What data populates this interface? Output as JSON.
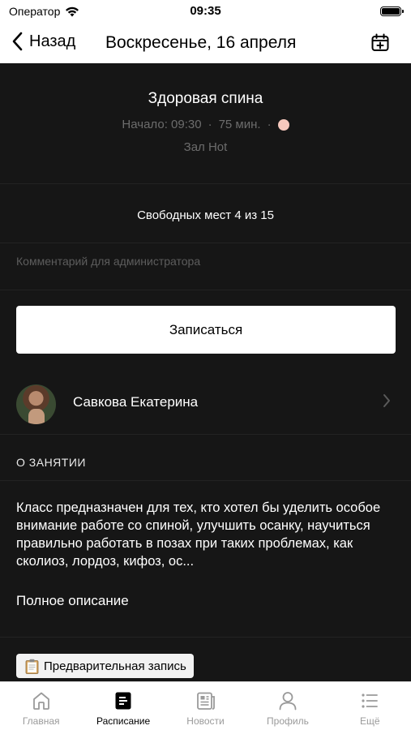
{
  "status_bar": {
    "carrier": "Оператор",
    "time": "09:35"
  },
  "nav": {
    "back_label": "Назад",
    "title": "Воскресенье, 16 апреля"
  },
  "class_info": {
    "name": "Здоровая спина",
    "start": "Начало: 09:30",
    "duration": "75 мин.",
    "separator": "·",
    "room": "Зал Hot",
    "color": "#f6c8bd"
  },
  "free_spots": "Свободных мест 4 из 15",
  "comment": {
    "placeholder": "Комментарий для администратора",
    "value": ""
  },
  "signup_label": "Записаться",
  "trainer": {
    "name": "Савкова Екатерина"
  },
  "about": {
    "heading": "О ЗАНЯТИИ",
    "text": "Класс предназначен для тех, кто хотел бы уделить особое внимание работе со спиной, улучшить осанку, научиться правильно работать в позах при таких проблемах, как сколиоз, лордоз, кифоз, ос...",
    "full_link": "Полное описание"
  },
  "prebook_label": "Предварительная запись",
  "tabs": [
    {
      "label": "Главная",
      "icon": "home-icon"
    },
    {
      "label": "Расписание",
      "icon": "schedule-icon"
    },
    {
      "label": "Новости",
      "icon": "news-icon"
    },
    {
      "label": "Профиль",
      "icon": "profile-icon"
    },
    {
      "label": "Ещё",
      "icon": "more-icon"
    }
  ],
  "active_tab_index": 1
}
